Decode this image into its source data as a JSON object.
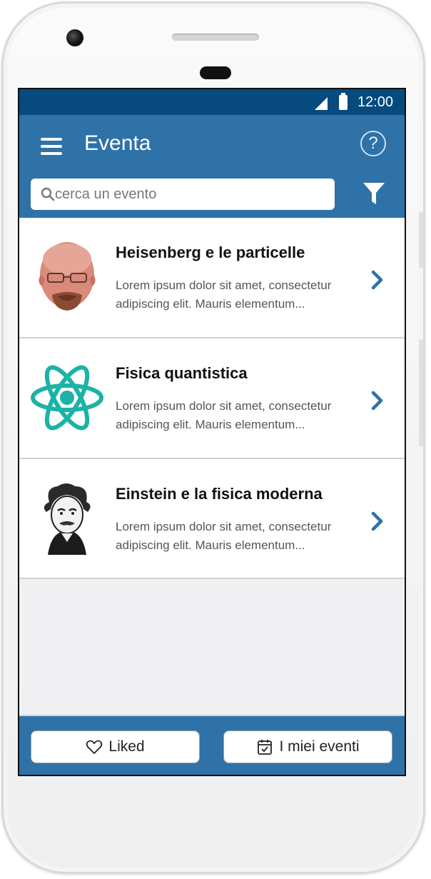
{
  "status_bar": {
    "time": "12:00"
  },
  "app_bar": {
    "title": "Eventa"
  },
  "search": {
    "placeholder": "cerca un evento"
  },
  "events": [
    {
      "title": "Heisenberg e le particelle",
      "description": "Lorem ipsum dolor sit amet, consectetur adipiscing elit. Mauris elementum...",
      "thumb_icon": "heisenberg-portrait"
    },
    {
      "title": "Fisica quantistica",
      "description": "Lorem ipsum dolor sit amet, consectetur adipiscing elit. Mauris elementum...",
      "thumb_icon": "atom-icon"
    },
    {
      "title": "Einstein e la fisica moderna",
      "description": "Lorem ipsum dolor sit amet, consectetur adipiscing elit. Mauris elementum...",
      "thumb_icon": "einstein-portrait"
    }
  ],
  "bottom_bar": {
    "liked_label": "Liked",
    "my_events_label": "I miei eventi"
  },
  "colors": {
    "status_bar": "#064a7e",
    "app_bar": "#2e72a8",
    "accent": "#2e72a8",
    "atom": "#1ab3a6"
  }
}
